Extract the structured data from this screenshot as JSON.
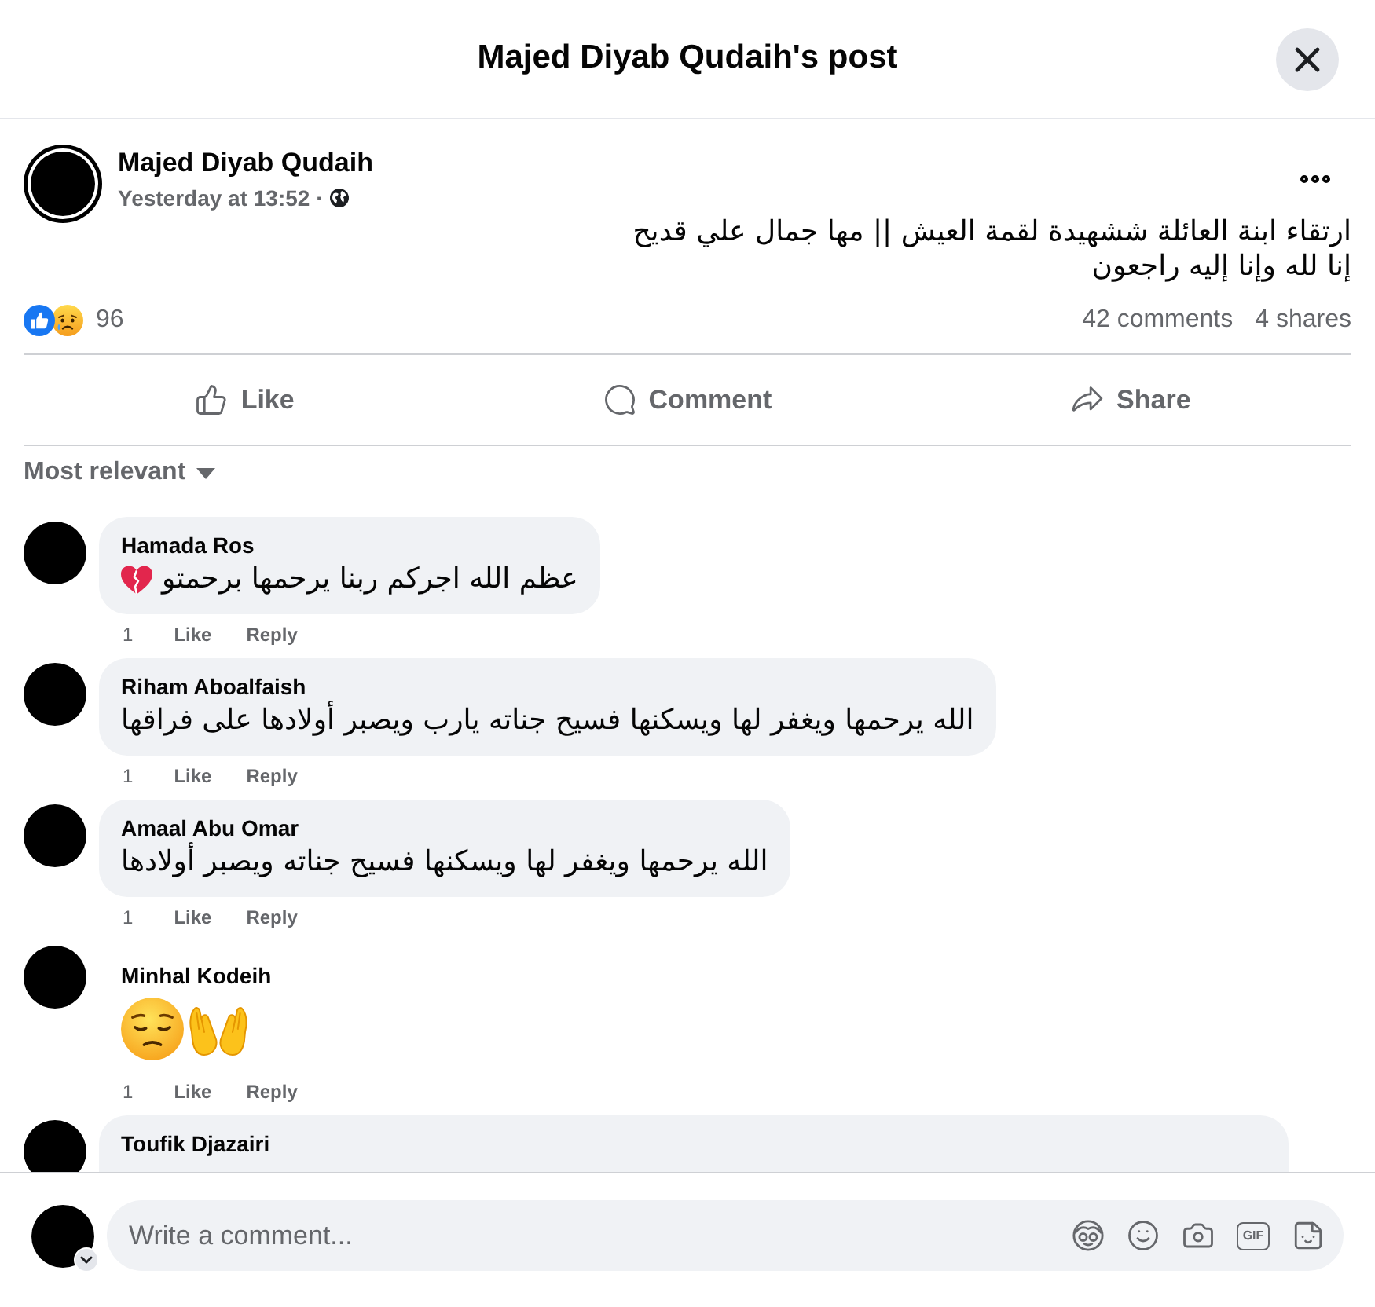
{
  "dialog": {
    "title": "Majed Diyab Qudaih's post"
  },
  "post": {
    "author": "Majed Diyab Qudaih",
    "time": "Yesterday at 13:52 ·",
    "text": "ارتقاء ابنة العائلة ششهيدة لقمة العيش || مها جمال علي قديح\nإنا لله وإنا إليه راجعون",
    "reaction_count": "96",
    "comments_count": "42 comments",
    "shares_count": "4 shares"
  },
  "actions": [
    {
      "label": "Like",
      "kind": "like"
    },
    {
      "label": "Comment",
      "kind": "comment"
    },
    {
      "label": "Share",
      "kind": "share"
    }
  ],
  "sort": {
    "label": "Most relevant"
  },
  "comments": [
    {
      "author": "Hamada Ros",
      "kind": "mixed",
      "text": "عظم الله اجركم ربنا يرحمها برحمتو",
      "time": "1",
      "like": "Like",
      "reply": "Reply"
    },
    {
      "author": "Riham Aboalfaish",
      "kind": "text",
      "text": "الله يرحمها ويغفر لها ويسكنها فسيح جناته يارب ويصبر أولادها على فراقها",
      "time": "1",
      "like": "Like",
      "reply": "Reply"
    },
    {
      "author": "Amaal Abu Omar",
      "kind": "text",
      "text": "الله يرحمها ويغفر لها ويسكنها فسيح جناته ويصبر أولادها",
      "time": "1",
      "like": "Like",
      "reply": "Reply"
    },
    {
      "author": "Minhal Kodeih",
      "kind": "emoji",
      "time": "1",
      "like": "Like",
      "reply": "Reply"
    },
    {
      "author": "Toufik Djazairi",
      "kind": "text"
    }
  ],
  "composer": {
    "placeholder": "Write a comment...",
    "gif_label": "GIF"
  }
}
